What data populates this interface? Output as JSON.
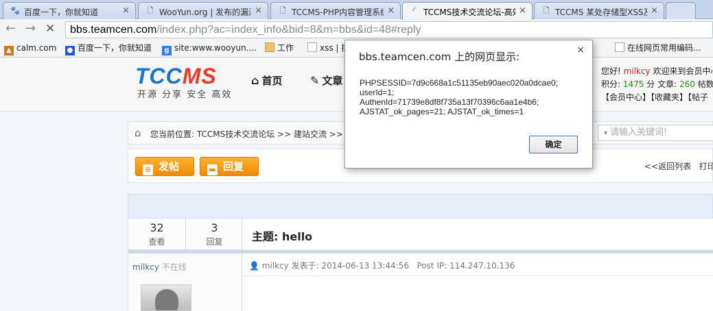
{
  "browser": {
    "tabs": [
      {
        "label": "百度一下，你就知道",
        "icon": "paw-icon"
      },
      {
        "label": "WooYun.org | 发布的漏洞",
        "icon": "page-icon"
      },
      {
        "label": "TCCMS-PHP内容管理系统",
        "icon": "page-icon"
      },
      {
        "label": "TCCMS技术交流论坛-高效",
        "icon": "loading-icon"
      },
      {
        "label": "TCCMS 某处存储型XSS及",
        "icon": "page-icon"
      }
    ],
    "url_host": "bbs.teamcen.com",
    "url_path": "/index.php?ac=index_info&bid=8&m=bbs&id=48#reply",
    "bookmarks": [
      {
        "label": "calm.com"
      },
      {
        "label": "百度一下，你就知道"
      },
      {
        "label": "site:www.wooyun...."
      },
      {
        "label": "工作"
      },
      {
        "label": "xss | 搜"
      },
      {
        "label": "在线网页常用编码..."
      }
    ]
  },
  "site": {
    "logo_tc": "TCC",
    "logo_ms": "MS",
    "slogan": "开源 分享 安全 高效",
    "nav": [
      {
        "label": "首页"
      },
      {
        "label": "文章"
      }
    ],
    "user": {
      "greeting": "您好!",
      "name": "milkcy",
      "welcome": "欢迎来到会员中心",
      "points_label": "积分:",
      "points": "1475",
      "articles_label": "分 文章:",
      "articles": "260",
      "posts_label": "帖数",
      "links": "【会员中心】【收藏夹】【帖子"
    }
  },
  "breadcrumb": {
    "text": "您当前位置: TCCMS技术交流论坛 >> 建站交流 >> 查",
    "search_placeholder": "请输入关键词!"
  },
  "actions": {
    "post": "发帖",
    "reply": "回复",
    "back": "<<返回列表",
    "print": "打印"
  },
  "thread": {
    "views": "32",
    "views_label": "查看",
    "replies": "3",
    "replies_label": "回复",
    "author": "milkcy",
    "author_status": "不在线",
    "subject": "主题: hello",
    "posted_by": "milkcy",
    "posted_label": "发表于:",
    "posted_at": "2014-06-13 13:44:56",
    "ip_label": "Post IP:",
    "ip": "114.247.10.136"
  },
  "dialog": {
    "title": "bbs.teamcen.com 上的网页显示:",
    "message": "PHPSESSID=7d9c668a1c51135eb90aec020a0dcae0;\nuserId=1;\nAuthenId=71739e8df8f735a13f70396c6aa1e4b6;\nAJSTAT_ok_pages=21; AJSTAT_ok_times=1",
    "ok": "确定",
    "close": "×"
  },
  "colors": {
    "accent_orange": "#f08a08",
    "logo_blue": "#1b74c5",
    "logo_red": "#e8392b",
    "user_red": "#d02020",
    "stat_green": "#2d8a12"
  }
}
